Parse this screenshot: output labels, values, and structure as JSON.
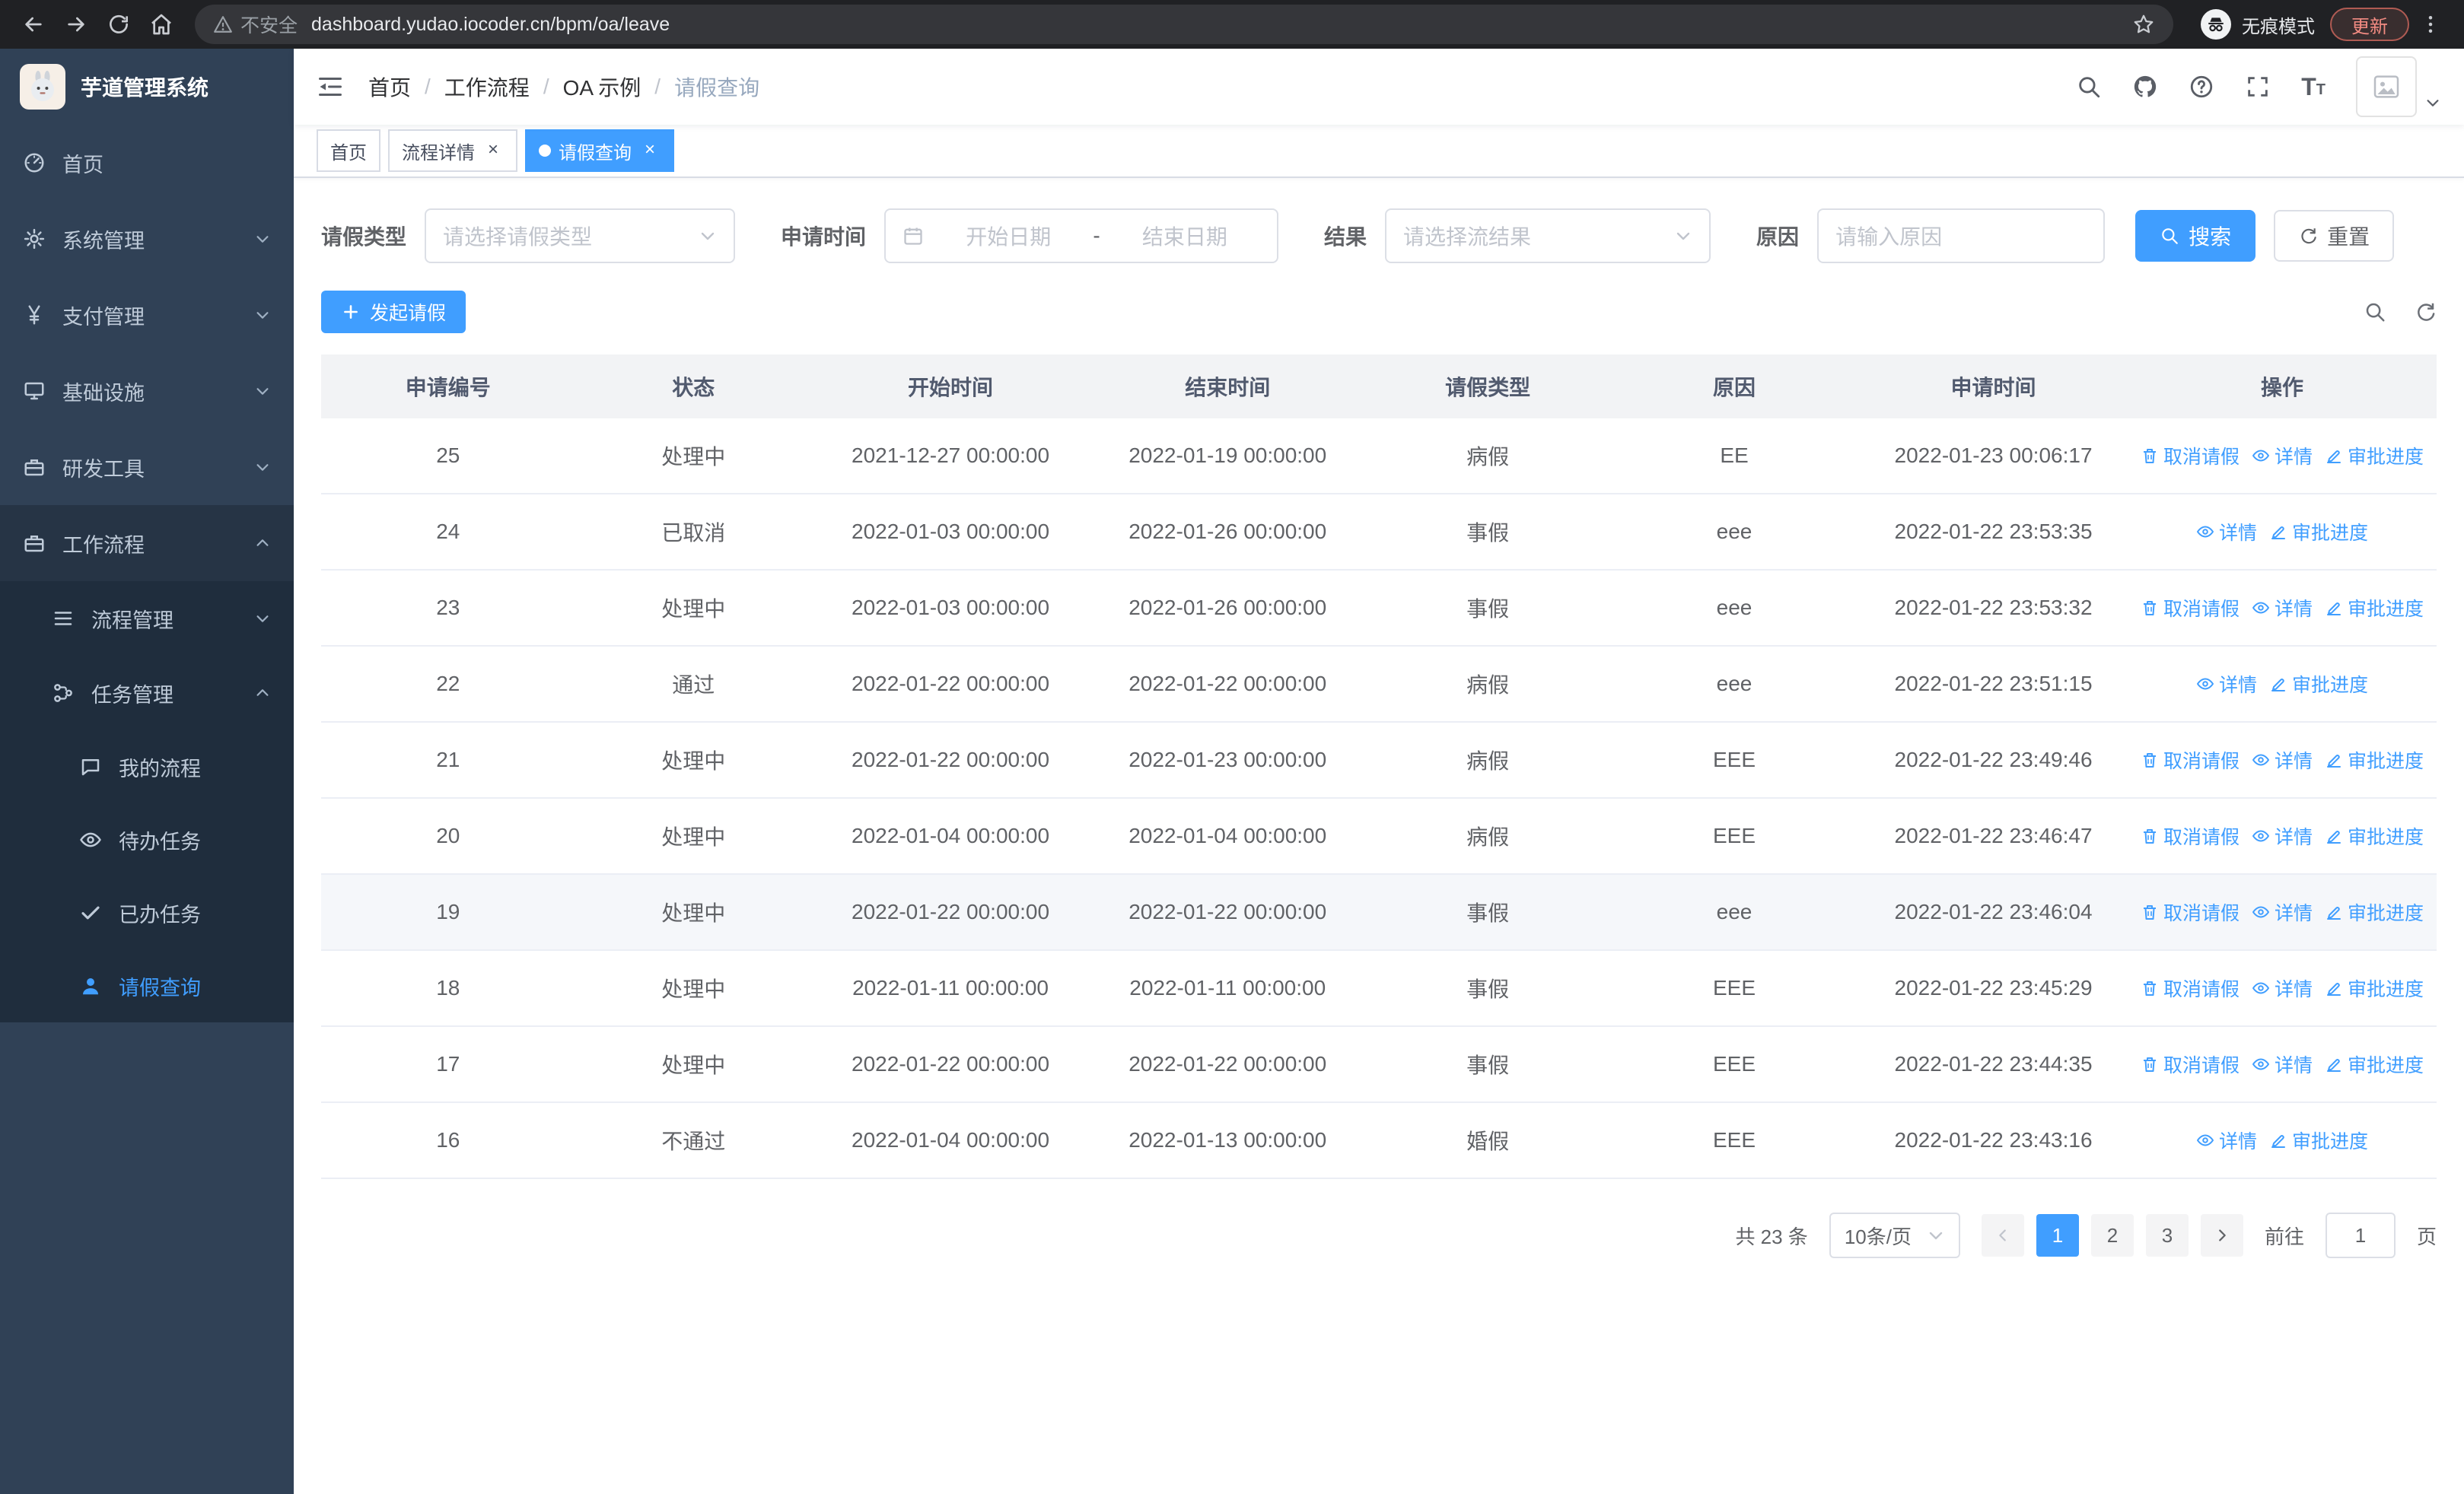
{
  "colors": {
    "primary": "#409EFF",
    "sidebar_bg": "#304156",
    "submenu_bg": "#1f2d3d",
    "chrome_bg": "#202124",
    "active_tab": "#409EFF"
  },
  "browser": {
    "security_chip": "不安全",
    "url": "dashboard.yudao.iocoder.cn/bpm/oa/leave",
    "incognito_label": "无痕模式",
    "update_label": "更新"
  },
  "sidebar": {
    "logo_title": "芋道管理系统",
    "items": [
      {
        "name": "home",
        "label": "首页",
        "icon": "i-dashboard",
        "icon_name": "dashboard-icon",
        "level": 1,
        "expandable": false,
        "expanded": false,
        "active": false
      },
      {
        "name": "system-management",
        "label": "系统管理",
        "icon": "i-gear",
        "icon_name": "gear-icon",
        "level": 1,
        "expandable": true,
        "expanded": false,
        "active": false
      },
      {
        "name": "payment-management",
        "label": "支付管理",
        "icon": "i-yen",
        "icon_name": "yen-icon",
        "level": 1,
        "expandable": true,
        "expanded": false,
        "active": false
      },
      {
        "name": "infrastructure",
        "label": "基础设施",
        "icon": "i-monitor",
        "icon_name": "monitor-icon",
        "level": 1,
        "expandable": true,
        "expanded": false,
        "active": false
      },
      {
        "name": "dev-tools",
        "label": "研发工具",
        "icon": "i-case",
        "icon_name": "briefcase-icon",
        "level": 1,
        "expandable": true,
        "expanded": false,
        "active": false
      },
      {
        "name": "workflow",
        "label": "工作流程",
        "icon": "i-case",
        "icon_name": "briefcase-icon",
        "level": 1,
        "expandable": true,
        "expanded": true,
        "active": false
      },
      {
        "name": "process-management",
        "label": "流程管理",
        "icon": "i-tree",
        "icon_name": "list-icon",
        "level": 2,
        "expandable": true,
        "expanded": false,
        "active": false
      },
      {
        "name": "task-management",
        "label": "任务管理",
        "icon": "i-flow",
        "icon_name": "flow-icon",
        "level": 2,
        "expandable": true,
        "expanded": true,
        "active": false
      },
      {
        "name": "my-process",
        "label": "我的流程",
        "icon": "i-message",
        "icon_name": "message-icon",
        "level": 3,
        "expandable": false,
        "expanded": false,
        "active": false
      },
      {
        "name": "todo-tasks",
        "label": "待办任务",
        "icon": "i-eye",
        "icon_name": "eye-icon",
        "level": 3,
        "expandable": false,
        "expanded": false,
        "active": false
      },
      {
        "name": "done-tasks",
        "label": "已办任务",
        "icon": "i-done",
        "icon_name": "check-icon",
        "level": 3,
        "expandable": false,
        "expanded": false,
        "active": false
      },
      {
        "name": "leave-query",
        "label": "请假查询",
        "icon": "i-user",
        "icon_name": "user-icon",
        "level": 3,
        "expandable": false,
        "expanded": false,
        "active": true
      }
    ]
  },
  "header": {
    "breadcrumb": [
      "首页",
      "工作流程",
      "OA 示例",
      "请假查询"
    ],
    "breadcrumb_separator": "/"
  },
  "tabs": [
    {
      "name": "home",
      "label": "首页",
      "closable": false,
      "active": false
    },
    {
      "name": "process-detail",
      "label": "流程详情",
      "closable": true,
      "active": false
    },
    {
      "name": "leave-query",
      "label": "请假查询",
      "closable": true,
      "active": true
    }
  ],
  "filters": {
    "leave_type_label": "请假类型",
    "leave_type_placeholder": "请选择请假类型",
    "apply_time_label": "申请时间",
    "start_date_placeholder": "开始日期",
    "range_separator": "-",
    "end_date_placeholder": "结束日期",
    "result_label": "结果",
    "result_placeholder": "请选择流结果",
    "reason_label": "原因",
    "reason_placeholder": "请输入原因",
    "search_label": "搜索",
    "reset_label": "重置"
  },
  "toolbar": {
    "create_label": "发起请假"
  },
  "table": {
    "columns": [
      "申请编号",
      "状态",
      "开始时间",
      "结束时间",
      "请假类型",
      "原因",
      "申请时间",
      "操作"
    ],
    "action_labels": {
      "cancel": "取消请假",
      "detail": "详情",
      "progress": "审批进度"
    },
    "rows": [
      {
        "id": "25",
        "status": "处理中",
        "start": "2021-12-27 00:00:00",
        "end": "2022-01-19 00:00:00",
        "type": "病假",
        "reason": "EE",
        "apply_time": "2022-01-23 00:06:17",
        "cancelable": true,
        "highlight": false
      },
      {
        "id": "24",
        "status": "已取消",
        "start": "2022-01-03 00:00:00",
        "end": "2022-01-26 00:00:00",
        "type": "事假",
        "reason": "eee",
        "apply_time": "2022-01-22 23:53:35",
        "cancelable": false,
        "highlight": false
      },
      {
        "id": "23",
        "status": "处理中",
        "start": "2022-01-03 00:00:00",
        "end": "2022-01-26 00:00:00",
        "type": "事假",
        "reason": "eee",
        "apply_time": "2022-01-22 23:53:32",
        "cancelable": true,
        "highlight": false
      },
      {
        "id": "22",
        "status": "通过",
        "start": "2022-01-22 00:00:00",
        "end": "2022-01-22 00:00:00",
        "type": "病假",
        "reason": "eee",
        "apply_time": "2022-01-22 23:51:15",
        "cancelable": false,
        "highlight": false
      },
      {
        "id": "21",
        "status": "处理中",
        "start": "2022-01-22 00:00:00",
        "end": "2022-01-23 00:00:00",
        "type": "病假",
        "reason": "EEE",
        "apply_time": "2022-01-22 23:49:46",
        "cancelable": true,
        "highlight": false
      },
      {
        "id": "20",
        "status": "处理中",
        "start": "2022-01-04 00:00:00",
        "end": "2022-01-04 00:00:00",
        "type": "病假",
        "reason": "EEE",
        "apply_time": "2022-01-22 23:46:47",
        "cancelable": true,
        "highlight": false
      },
      {
        "id": "19",
        "status": "处理中",
        "start": "2022-01-22 00:00:00",
        "end": "2022-01-22 00:00:00",
        "type": "事假",
        "reason": "eee",
        "apply_time": "2022-01-22 23:46:04",
        "cancelable": true,
        "highlight": true
      },
      {
        "id": "18",
        "status": "处理中",
        "start": "2022-01-11 00:00:00",
        "end": "2022-01-11 00:00:00",
        "type": "事假",
        "reason": "EEE",
        "apply_time": "2022-01-22 23:45:29",
        "cancelable": true,
        "highlight": false
      },
      {
        "id": "17",
        "status": "处理中",
        "start": "2022-01-22 00:00:00",
        "end": "2022-01-22 00:00:00",
        "type": "事假",
        "reason": "EEE",
        "apply_time": "2022-01-22 23:44:35",
        "cancelable": true,
        "highlight": false
      },
      {
        "id": "16",
        "status": "不通过",
        "start": "2022-01-04 00:00:00",
        "end": "2022-01-13 00:00:00",
        "type": "婚假",
        "reason": "EEE",
        "apply_time": "2022-01-22 23:43:16",
        "cancelable": false,
        "highlight": false
      }
    ]
  },
  "pagination": {
    "total_text": "共 23 条",
    "page_size": "10条/页",
    "pages": [
      "1",
      "2",
      "3"
    ],
    "active_page": "1",
    "goto_label": "前往",
    "goto_value": "1",
    "page_label": "页"
  }
}
